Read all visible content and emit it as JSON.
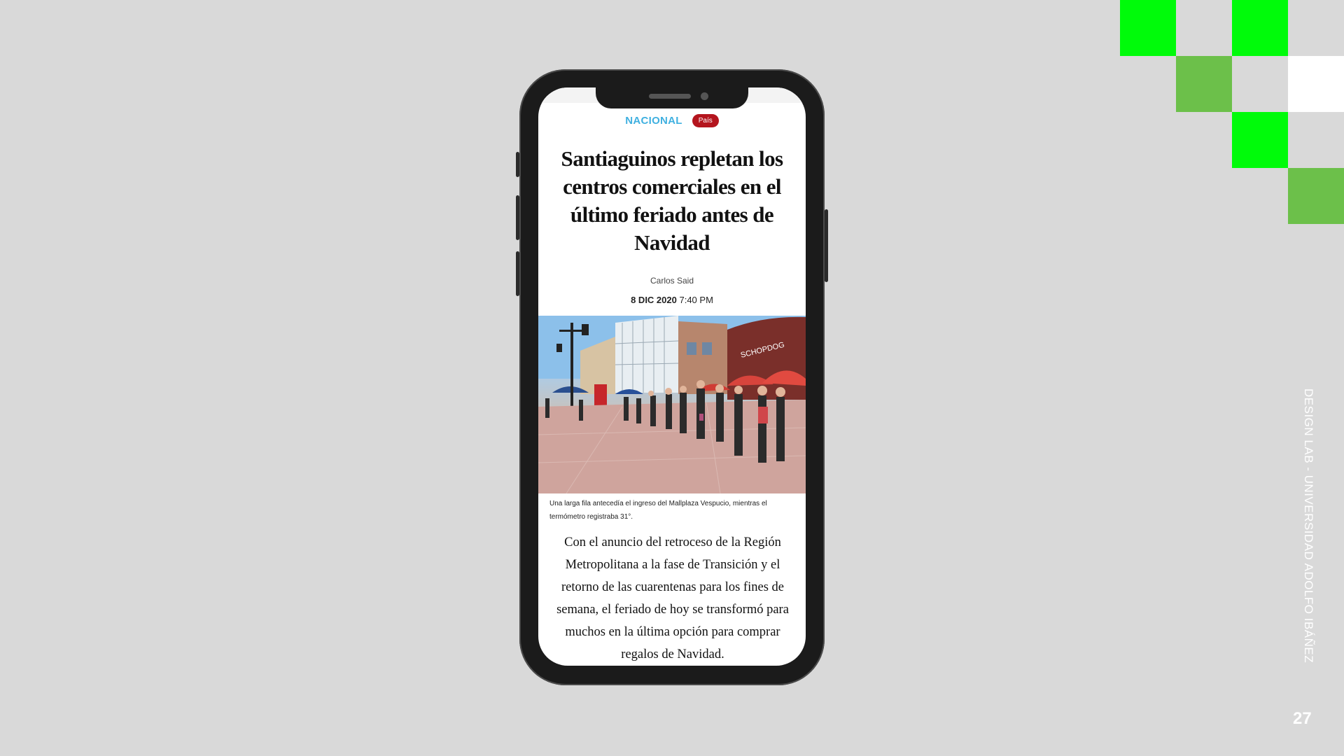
{
  "article": {
    "section": "NACIONAL",
    "tag": "País",
    "headline": "Santiaguinos repletan los centros comerciales en el último feriado antes de Navidad",
    "author": "Carlos Said",
    "date": "8 DIC 2020",
    "time": "7:40 PM",
    "photo_caption": "Una larga fila antecedía el ingreso del Mallplaza Vespucio, mientras el termómetro registraba 31°.",
    "photo_sign": "SCHOPDOG",
    "body": "Con el anuncio del retroceso de la Región Metropolitana a la fase de Transición y el retorno de las cuarentenas para los fines de semana, el feriado de hoy se transformó para muchos en la última opción para comprar regalos de Navidad."
  },
  "slide": {
    "side_text": "DESIGN LAB - UNIVERSIDAD ADOLFO IBÁÑEZ",
    "page_number": "27"
  },
  "colors": {
    "background": "#d9d9d9",
    "accent_green": "#00fb0a",
    "muted_green": "#6cc04a",
    "section_blue": "#3fb0e0",
    "tag_red": "#b4151e"
  }
}
